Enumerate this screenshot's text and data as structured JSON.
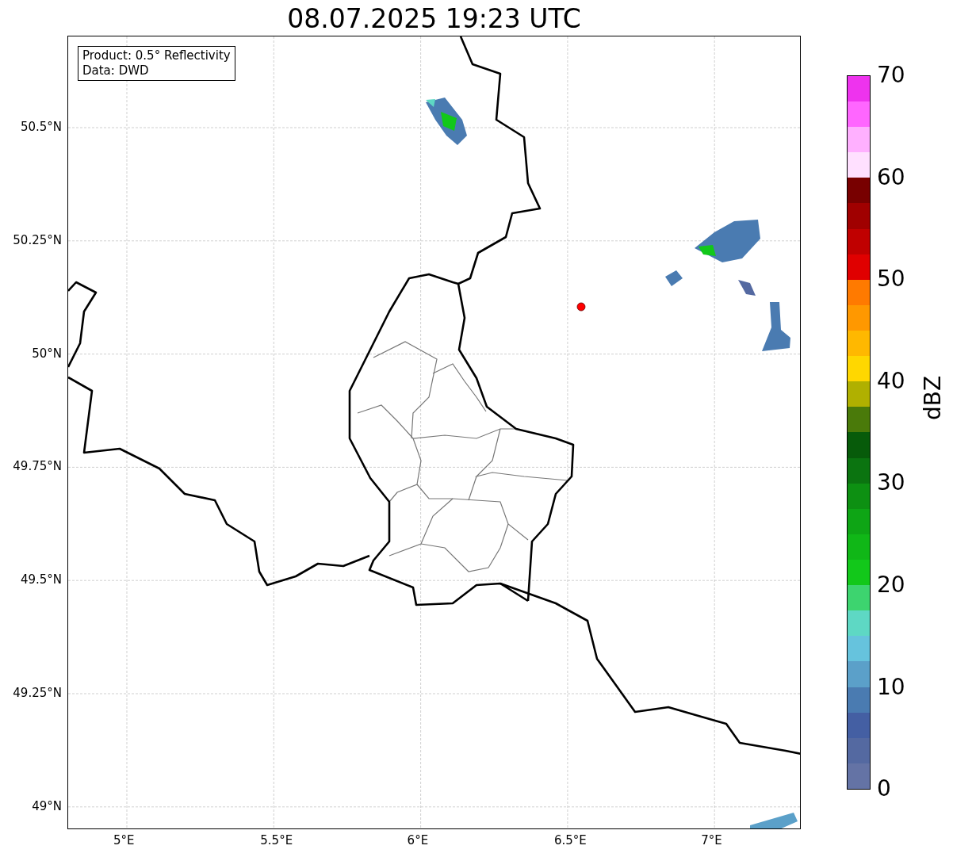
{
  "title": "08.07.2025 19:23 UTC",
  "info_box": [
    "Product: 0.5° Reflectivity",
    "Data: DWD"
  ],
  "map": {
    "lat_ticks": [
      "50.5°N",
      "50.25°N",
      "50°N",
      "49.75°N",
      "49.5°N",
      "49.25°N",
      "49°N"
    ],
    "lon_ticks": [
      "5°E",
      "5.5°E",
      "6°E",
      "6.5°E",
      "7°E"
    ]
  },
  "colorbar": {
    "label": "dBZ",
    "ticks": [
      "70",
      "60",
      "50",
      "40",
      "30",
      "20",
      "10",
      "0"
    ],
    "bins": [
      {
        "color": "#6473a5"
      },
      {
        "color": "#5469a1"
      },
      {
        "color": "#445fa3"
      },
      {
        "color": "#4a7bb1"
      },
      {
        "color": "#5ba0c9"
      },
      {
        "color": "#66c3dd"
      },
      {
        "color": "#5ed8c4"
      },
      {
        "color": "#3dd46f"
      },
      {
        "color": "#12c81a"
      },
      {
        "color": "#10b717"
      },
      {
        "color": "#0ea515"
      },
      {
        "color": "#0d9012"
      },
      {
        "color": "#0b7410"
      },
      {
        "color": "#075b0a"
      },
      {
        "color": "#4a7a0a"
      },
      {
        "color": "#b0b000"
      },
      {
        "color": "#ffd700"
      },
      {
        "color": "#ffb800"
      },
      {
        "color": "#ff9800"
      },
      {
        "color": "#ff7a00"
      },
      {
        "color": "#e00000"
      },
      {
        "color": "#c00000"
      },
      {
        "color": "#a00000"
      },
      {
        "color": "#780000"
      },
      {
        "color": "#ffe0ff"
      },
      {
        "color": "#ffb0ff"
      },
      {
        "color": "#ff66ff"
      },
      {
        "color": "#ee33ee"
      }
    ]
  }
}
